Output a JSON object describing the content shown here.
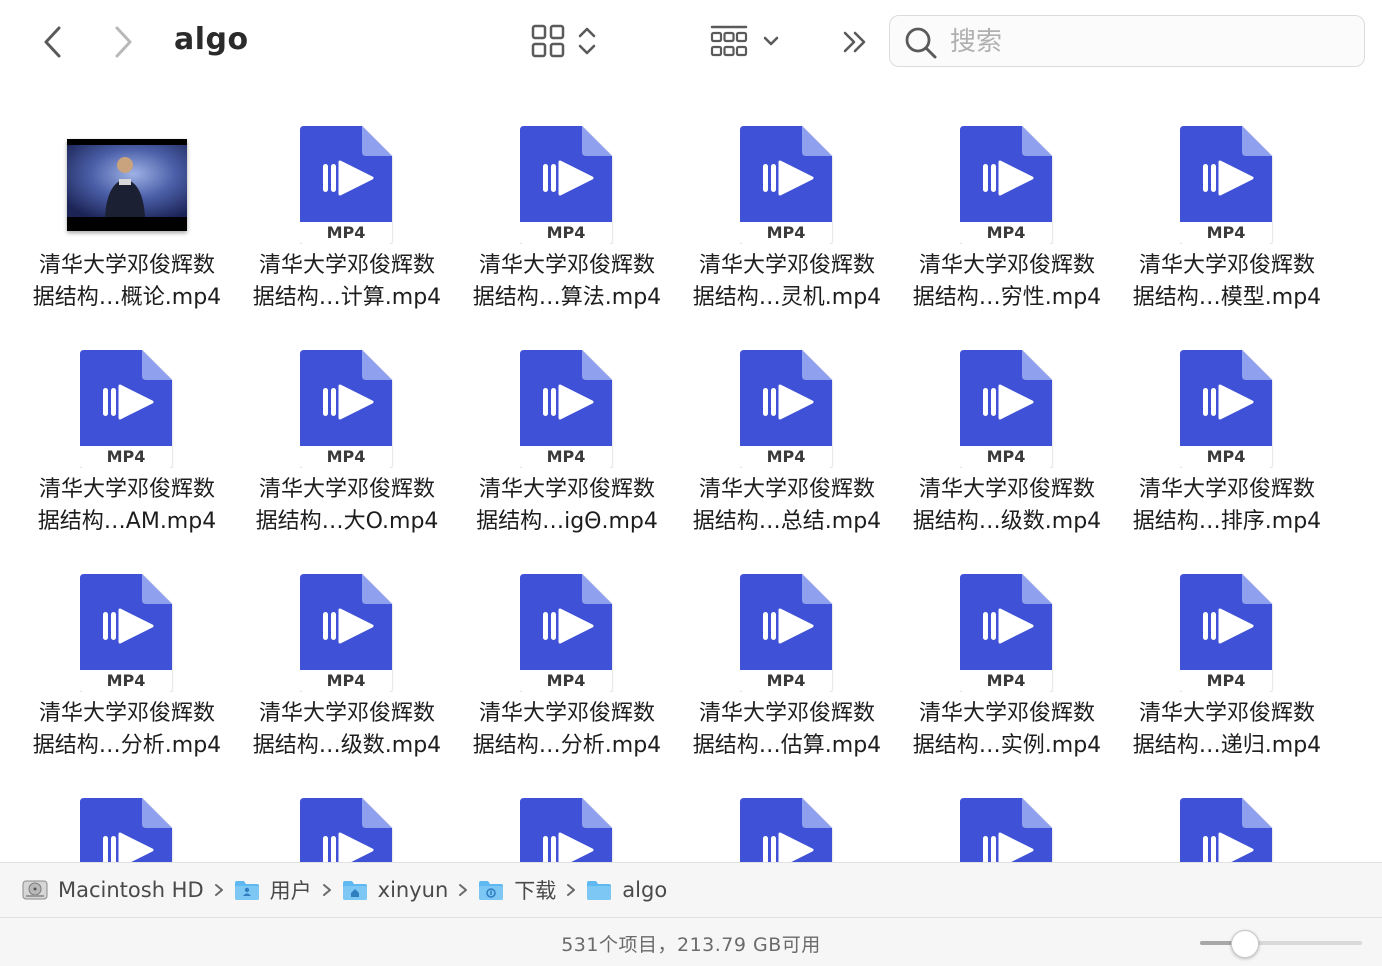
{
  "toolbar": {
    "title": "algo",
    "search_placeholder": "搜索"
  },
  "files": [
    {
      "line1": "清华大学邓俊辉数",
      "line2": "据结构…概论.mp4",
      "kind": "thumbnail"
    },
    {
      "line1": "清华大学邓俊辉数",
      "line2": "据结构…计算.mp4",
      "kind": "mp4"
    },
    {
      "line1": "清华大学邓俊辉数",
      "line2": "据结构…算法.mp4",
      "kind": "mp4"
    },
    {
      "line1": "清华大学邓俊辉数",
      "line2": "据结构…灵机.mp4",
      "kind": "mp4"
    },
    {
      "line1": "清华大学邓俊辉数",
      "line2": "据结构…穷性.mp4",
      "kind": "mp4"
    },
    {
      "line1": "清华大学邓俊辉数",
      "line2": "据结构…模型.mp4",
      "kind": "mp4"
    },
    {
      "line1": "清华大学邓俊辉数",
      "line2": "据结构…AM.mp4",
      "kind": "mp4"
    },
    {
      "line1": "清华大学邓俊辉数",
      "line2": "据结构…大O.mp4",
      "kind": "mp4"
    },
    {
      "line1": "清华大学邓俊辉数",
      "line2": "据结构…igΘ.mp4",
      "kind": "mp4"
    },
    {
      "line1": "清华大学邓俊辉数",
      "line2": "据结构…总结.mp4",
      "kind": "mp4"
    },
    {
      "line1": "清华大学邓俊辉数",
      "line2": "据结构…级数.mp4",
      "kind": "mp4"
    },
    {
      "line1": "清华大学邓俊辉数",
      "line2": "据结构…排序.mp4",
      "kind": "mp4"
    },
    {
      "line1": "清华大学邓俊辉数",
      "line2": "据结构…分析.mp4",
      "kind": "mp4"
    },
    {
      "line1": "清华大学邓俊辉数",
      "line2": "据结构…级数.mp4",
      "kind": "mp4"
    },
    {
      "line1": "清华大学邓俊辉数",
      "line2": "据结构…分析.mp4",
      "kind": "mp4"
    },
    {
      "line1": "清华大学邓俊辉数",
      "line2": "据结构…估算.mp4",
      "kind": "mp4"
    },
    {
      "line1": "清华大学邓俊辉数",
      "line2": "据结构…实例.mp4",
      "kind": "mp4"
    },
    {
      "line1": "清华大学邓俊辉数",
      "line2": "据结构…递归.mp4",
      "kind": "mp4"
    },
    {
      "line1": "",
      "line2": "",
      "kind": "mp4"
    },
    {
      "line1": "",
      "line2": "",
      "kind": "mp4"
    },
    {
      "line1": "",
      "line2": "",
      "kind": "mp4"
    },
    {
      "line1": "",
      "line2": "",
      "kind": "mp4"
    },
    {
      "line1": "",
      "line2": "",
      "kind": "mp4"
    },
    {
      "line1": "",
      "line2": "",
      "kind": "mp4"
    }
  ],
  "file_badge": "MP4",
  "pathbar": [
    {
      "label": "Macintosh HD",
      "icon": "hard-drive-icon"
    },
    {
      "label": "用户",
      "icon": "folder-users-icon"
    },
    {
      "label": "xinyun",
      "icon": "folder-home-icon"
    },
    {
      "label": "下载",
      "icon": "folder-downloads-icon"
    },
    {
      "label": "algo",
      "icon": "folder-icon"
    }
  ],
  "status": {
    "text": "531个项目，213.79 GB可用",
    "zoom_level": 0.25
  },
  "colors": {
    "mp4_blue": "#3f51d6",
    "folder_blue": "#5fb8f0"
  }
}
